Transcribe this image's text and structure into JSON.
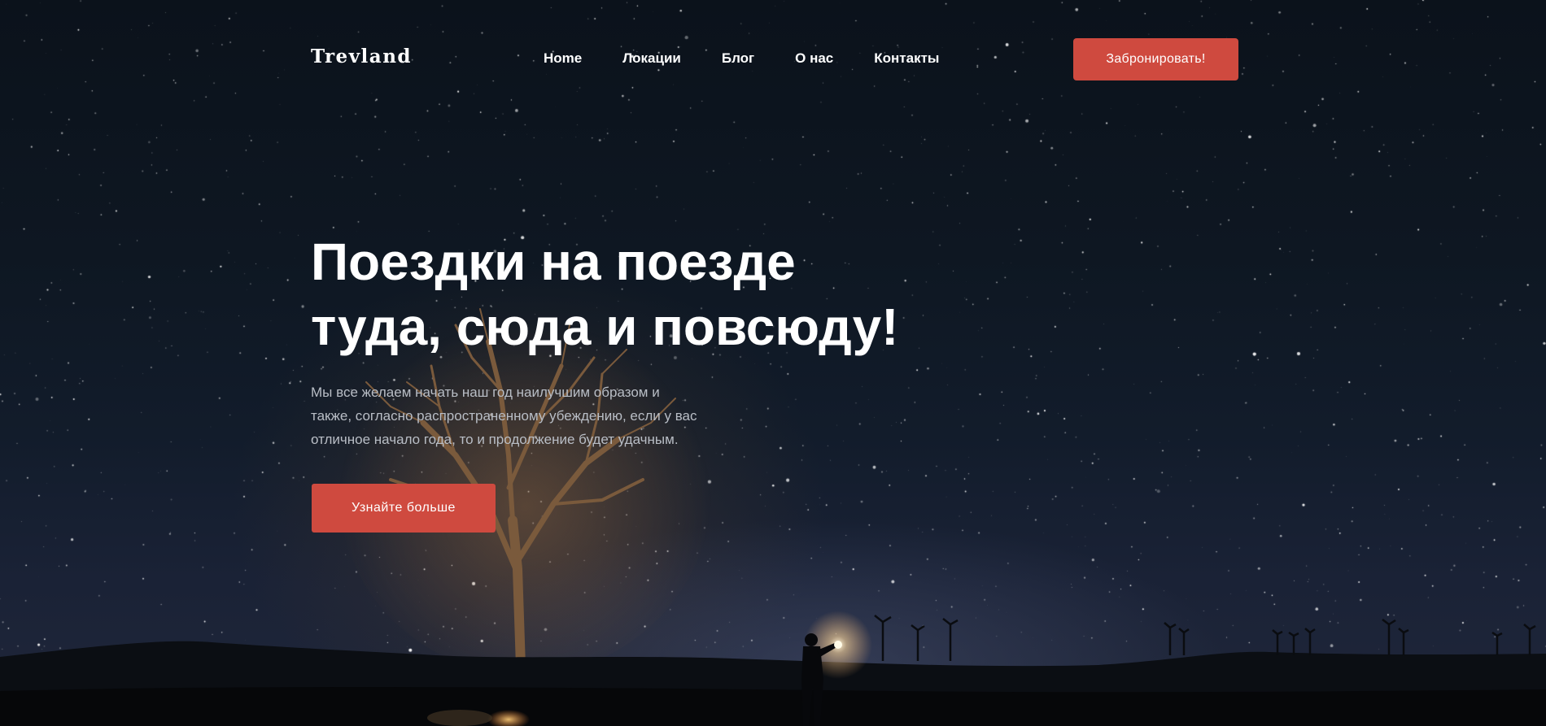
{
  "brand": {
    "logo": "Trevland"
  },
  "nav": {
    "items": [
      "Home",
      "Локации",
      "Блог",
      "О нас",
      "Контакты"
    ]
  },
  "header": {
    "cta_label": "Забронировать!"
  },
  "hero": {
    "title_line1": "Поездки на поезде",
    "title_line2": "туда, сюда и повсюду!",
    "description_lines": [
      "Мы все желаем начать наш год наилучшим образом и",
      "также, согласно распространенному убеждению, если у вас",
      "отличное начало года, то и продолжение будет удачным."
    ],
    "cta_label": "Узнайте больше"
  },
  "colors": {
    "accent": "#cf4a3f",
    "sky_top": "#0b121b",
    "sky_bottom": "#20273a",
    "ground": "#07090d",
    "text": "#ffffff",
    "muted_text": "#b9bec6"
  },
  "icons": {
    "background": "night-sky-photo",
    "tree": "bare-tree-silhouette",
    "person": "person-with-lantern-silhouette",
    "wind_turbines": "wind-turbine-icon"
  }
}
